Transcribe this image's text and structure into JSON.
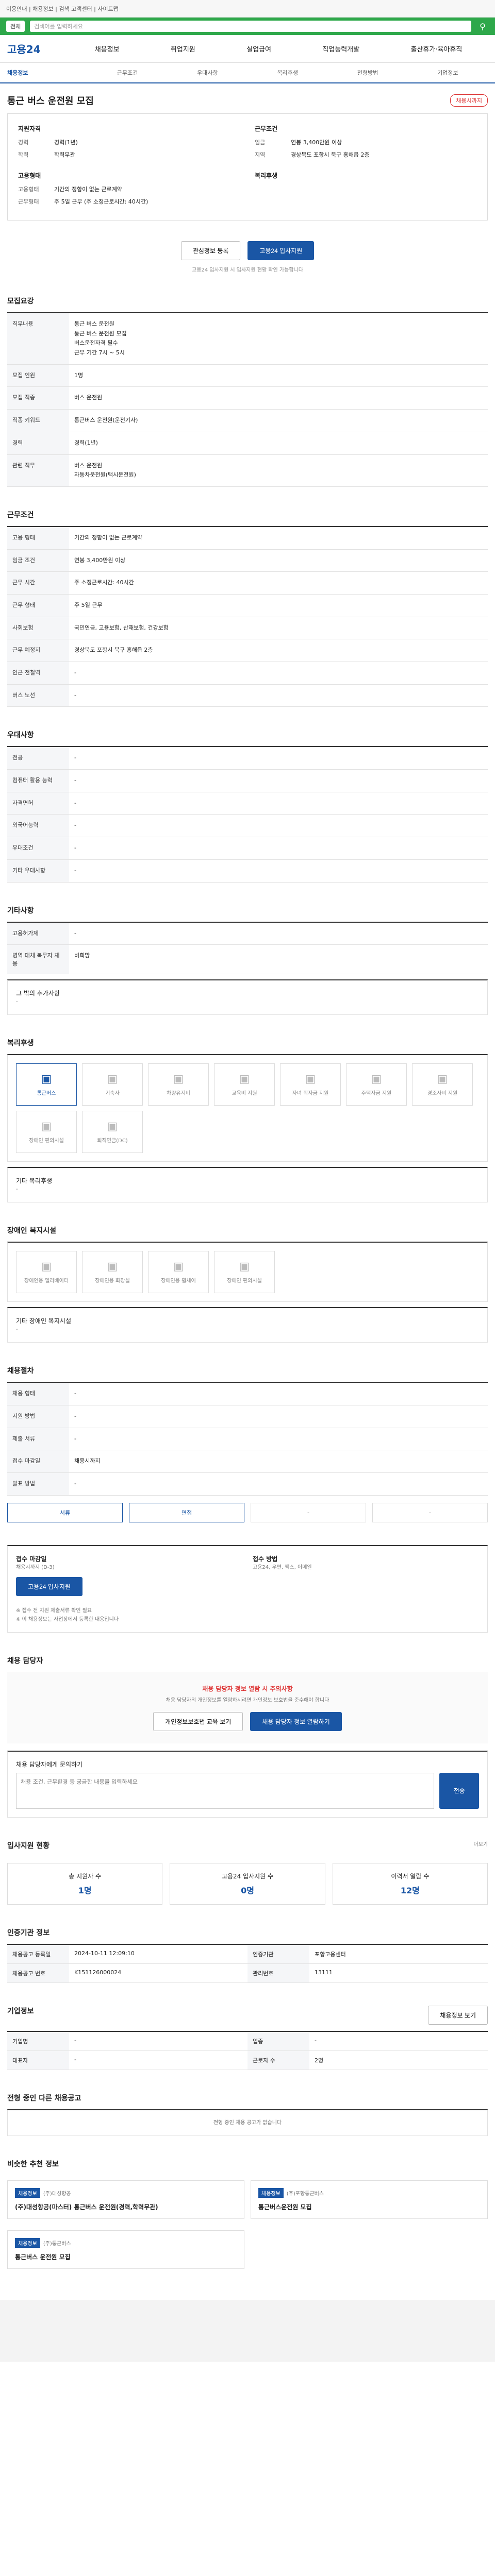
{
  "topbar": {
    "notice": "이용안내 | 채용정보 | 검색 고객센터 | 사이트맵"
  },
  "greenbar": {
    "select": "전체",
    "placeholder": "검색어를 입력하세요"
  },
  "gnb": {
    "logo": "고용24",
    "menu": [
      "채용정보",
      "취업지원",
      "실업급여",
      "직업능력개발",
      "출산휴가·육아휴직"
    ]
  },
  "tabs": [
    "채용정보",
    "근무조건",
    "우대사항",
    "복리후생",
    "전형방법",
    "기업정보"
  ],
  "job": {
    "title": "통근 버스 운전원 모집",
    "badge": "채용시까지",
    "left_title": "지원자격",
    "left": [
      {
        "k": "경력",
        "v": "경력(1년)"
      },
      {
        "k": "학력",
        "v": "학력무관"
      }
    ],
    "right_title": "근무조건",
    "right": [
      {
        "k": "임금",
        "v": "연봉 3,400만원 이상"
      },
      {
        "k": "지역",
        "v": "경상북도 포항시 북구 흥해읍 2층"
      }
    ],
    "left_title2": "고용형태",
    "left2": [
      {
        "k": "고용형태",
        "v": "기간의 정함이 없는 근로계약"
      },
      {
        "k": "근무형태",
        "v": "주 5일 근무 (주 소정근로시간: 40시간)"
      }
    ],
    "right_title2": "복리후생",
    "buttons": {
      "scrap": "관심정보 등록",
      "apply": "고용24 입사지원"
    },
    "note": "고용24 입사지원 시 입사지원 현황 확인 가능합니다"
  },
  "recruit": {
    "title": "모집요강",
    "job_desc_label": "직무내용",
    "job_desc": "통근 버스 운전원\n통근 버스 운전원 모집\n버스운전자격 필수\n근무 기간 7시 ~ 5시",
    "rows": [
      {
        "k": "모집 인원",
        "v": "1명"
      },
      {
        "k": "모집 직종",
        "v": "버스 운전원"
      },
      {
        "k": "직종 키워드",
        "v": "통근버스 운전원(운전기사)"
      },
      {
        "k": "경력",
        "v": "경력(1년)"
      },
      {
        "k": "관련 직무",
        "v": "버스 운전원\n자동차운전원(택시운전원)"
      }
    ]
  },
  "conditions": {
    "title": "근무조건",
    "rows": [
      {
        "k": "고용 형태",
        "v": "기간의 정함이 없는 근로계약"
      },
      {
        "k": "임금 조건",
        "v": "연봉 3,400만원 이상"
      },
      {
        "k": "근무 시간",
        "v": "주 소정근로시간: 40시간"
      },
      {
        "k": "근무 형태",
        "v": "주 5일 근무"
      },
      {
        "k": "사회보험",
        "v": "국민연금, 고용보험, 산재보험, 건강보험"
      },
      {
        "k": "근무 예정지",
        "v": "경상북도 포항시 북구 흥해읍 2층"
      },
      {
        "k": "인근 전철역",
        "v": "-"
      },
      {
        "k": "버스 노선",
        "v": "-"
      }
    ]
  },
  "preference": {
    "title": "우대사항",
    "rows": [
      {
        "k": "전공",
        "v": "-"
      },
      {
        "k": "컴퓨터 활용 능력",
        "v": "-"
      },
      {
        "k": "자격면허",
        "v": "-"
      },
      {
        "k": "외국어능력",
        "v": "-"
      },
      {
        "k": "우대조건",
        "v": "-"
      },
      {
        "k": "기타 우대사항",
        "v": "-"
      }
    ]
  },
  "etc": {
    "title": "기타사항",
    "rows": [
      {
        "k": "고용허가제",
        "v": "-"
      },
      {
        "k": "병역 대체 복무자 채용",
        "v": "비희망"
      }
    ],
    "extra_label": "그 밖의 추가사항",
    "extra": "-"
  },
  "welfare": {
    "title": "복리후생",
    "items": [
      "통근버스",
      "기숙사",
      "차량유지비",
      "교육비 지원",
      "자녀 학자금 지원",
      "주택자금 지원",
      "경조사비 지원",
      "장애인 편의시설",
      "퇴직연금(DC)"
    ],
    "on": [
      0
    ],
    "etc_label": "기타 복리후생",
    "etc": "-"
  },
  "disabled": {
    "title": "장애인 복지시설",
    "items": [
      "장애인용 엘리베이터",
      "장애인용 화장실",
      "장애인용 휠체어",
      "장애인 편의시설"
    ],
    "etc_label": "기타 장애인 복지시설",
    "etc": "-"
  },
  "screening": {
    "title": "채용절차",
    "rows": [
      {
        "k": "채용 형태",
        "v": "-"
      },
      {
        "k": "지원 방법",
        "v": "-"
      },
      {
        "k": "제출 서류",
        "v": "-"
      },
      {
        "k": "접수 마감일",
        "v": "채용시까지"
      },
      {
        "k": "발표 방법",
        "v": "-"
      }
    ],
    "methods": [
      "서류",
      "면접",
      "-",
      "-"
    ],
    "methods_on": [
      0,
      1
    ]
  },
  "apply": {
    "left_title": "접수 마감일",
    "left_v": "채용시까지 (D-3)",
    "right_title": "접수 방법",
    "right_v": "고용24, 우편, 팩스, 이메일",
    "notes": "※ 접수 전 지원 제출서류 확인 필요\n※ 이 채용정보는 사업장에서 등록한 내용입니다"
  },
  "manager": {
    "title": "채용 담당자",
    "warn": "채용 담당자 정보 열람 시 주의사항",
    "desc": "채용 담당자의 개인정보를 열람하시려면 개인정보 보호법을 준수해야 합니다",
    "btn1": "개인정보보호법 교육 보기",
    "btn2": "채용 담당자 정보 열람하기",
    "question_label": "채용 담당자에게 문의하기",
    "question_placeholder": "채용 조건, 근무환경 등 궁금한 내용을 입력하세요",
    "send": "전송"
  },
  "status": {
    "title": "입사지원 현황",
    "more": "더보기",
    "items": [
      {
        "k": "총 지원자 수",
        "v": "1명"
      },
      {
        "k": "고용24 입사지원 수",
        "v": "0명"
      },
      {
        "k": "이력서 열람 수",
        "v": "12명"
      }
    ]
  },
  "info": {
    "title": "인증기관 정보",
    "rows": [
      {
        "k": "채용공고 등록일",
        "v": "2024-10-11 12:09:10"
      },
      {
        "k": "인증기관",
        "v": "포항고용센터"
      },
      {
        "k": "채용공고 번호",
        "v": "K151126000024"
      },
      {
        "k": "관리번호",
        "v": "13111"
      }
    ]
  },
  "company": {
    "title": "기업정보",
    "rows": [
      {
        "k": "기업명",
        "v": "-"
      },
      {
        "k": "업종",
        "v": "-"
      },
      {
        "k": "대표자",
        "v": "-"
      },
      {
        "k": "근로자 수",
        "v": "2명"
      }
    ],
    "btn": "채용정보 보기"
  },
  "other": {
    "title": "전형 중인 다른 채용공고",
    "empty": "전형 중인 채용 공고가 없습니다"
  },
  "similar": {
    "title": "비슷한 추천 정보",
    "cards": [
      {
        "tag": "채용정보",
        "company": "(주)대성항공",
        "title": "(주)대성항공(마스터) 통근버스 운전원(경력,학력무관)"
      },
      {
        "tag": "채용정보",
        "company": "(주)포항통근버스",
        "title": "통근버스운전원 모집"
      },
      {
        "tag": "채용정보",
        "company": "(주)통근버스",
        "title": "통근버스 운전원 모집"
      }
    ]
  }
}
